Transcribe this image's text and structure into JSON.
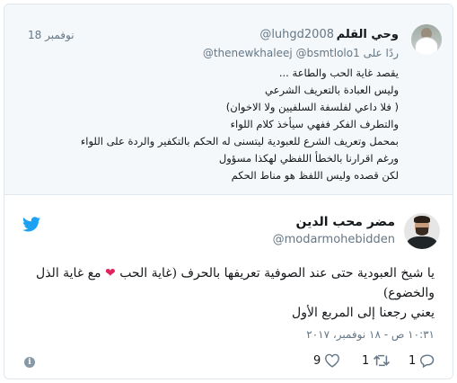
{
  "parent_tweet": {
    "name": "وحي القلم",
    "handle": "@luhgd2008",
    "date": "18 نوفمبر",
    "replying_prefix": "ردًا على",
    "replying_handles": "thenewkhaleej @bsmtlolo1@",
    "lines": [
      "يقصد غاية الحب والطاعة ...",
      "وليس العبادة بالتعريف الشرعي",
      "( فلا داعي لفلسفة السلفيين ولا الاخوان)",
      "والتطرف الفكر ففهي سيأخذ كلام اللواء",
      "بمحمل وتعريف الشرع للعبودية ليتسنى له الحكم بالتكفير والردة على اللواء",
      "ورغم اقرارنا بالخطأ اللفظي لهكذا مسؤول",
      "لكن قصده وليس اللفظ هو مناط الحكم"
    ]
  },
  "main_tweet": {
    "name": "مضر محب الدين",
    "handle": "@modarmohebidden",
    "text_line1_before": "يا شيخ العبودية حتى عند الصوفية تعريفها بالحرف (غاية الحب",
    "text_line1_after": "مع غاية الذل",
    "text_line2": "والخضوع)",
    "text_line3": "يعني رجعنا إلى المربع الأول",
    "timestamp": "١٠:٣١ ص - ١٨ نوفمبر، ٢٠١٧",
    "counts": {
      "replies": "1",
      "retweets": "1",
      "likes": "9"
    }
  },
  "icons": {
    "brand": "twitter-bird-icon",
    "reply": "reply-icon",
    "retweet": "retweet-icon",
    "like": "heart-icon",
    "info": "info-icon",
    "heart_emoji": "heart-emoji-icon"
  },
  "colors": {
    "brand": "#1da1f2",
    "heart": "#e0245e",
    "muted": "#657786"
  }
}
